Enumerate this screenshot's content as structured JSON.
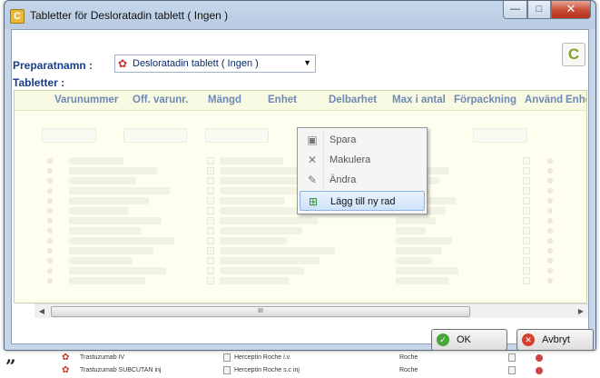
{
  "window": {
    "title": "Tabletter för Desloratadin tablett ( Ingen )",
    "controls": {
      "minimize": "—",
      "maximize": "□",
      "close": "✕"
    },
    "logo_letter": "C"
  },
  "form": {
    "preparatnamn_label": "Preparatnamn :",
    "preparatnamn_value": "Desloratadin tablett ( Ingen )",
    "tabletter_label": "Tabletter :"
  },
  "grid": {
    "columns": [
      "Varunummer",
      "Off. varunr.",
      "Mängd",
      "Enhet",
      "Delbarhet",
      "Max i antal",
      "Förpackning",
      "Använd",
      "Enhet"
    ]
  },
  "scrollbar": {
    "thumb_grip": "III"
  },
  "context_menu": {
    "items": [
      {
        "label": "Spara",
        "icon": "save-icon"
      },
      {
        "label": "Makulera",
        "icon": "cross-icon"
      },
      {
        "label": "Ändra",
        "icon": "edit-icon"
      },
      {
        "label": "Lägg till ny rad",
        "icon": "add-row-icon"
      }
    ]
  },
  "buttons": {
    "ok": "OK",
    "cancel": "Avbryt"
  },
  "background": {
    "quote": "”",
    "rows": [
      {
        "name": "Trastuzumab IV",
        "product": "Herceptin Roche i.v.",
        "maker": "Roche"
      },
      {
        "name": "Trastuzumab SUBCUTAN inj",
        "product": "Herceptin Roche s.c inj",
        "maker": "Roche"
      }
    ]
  }
}
